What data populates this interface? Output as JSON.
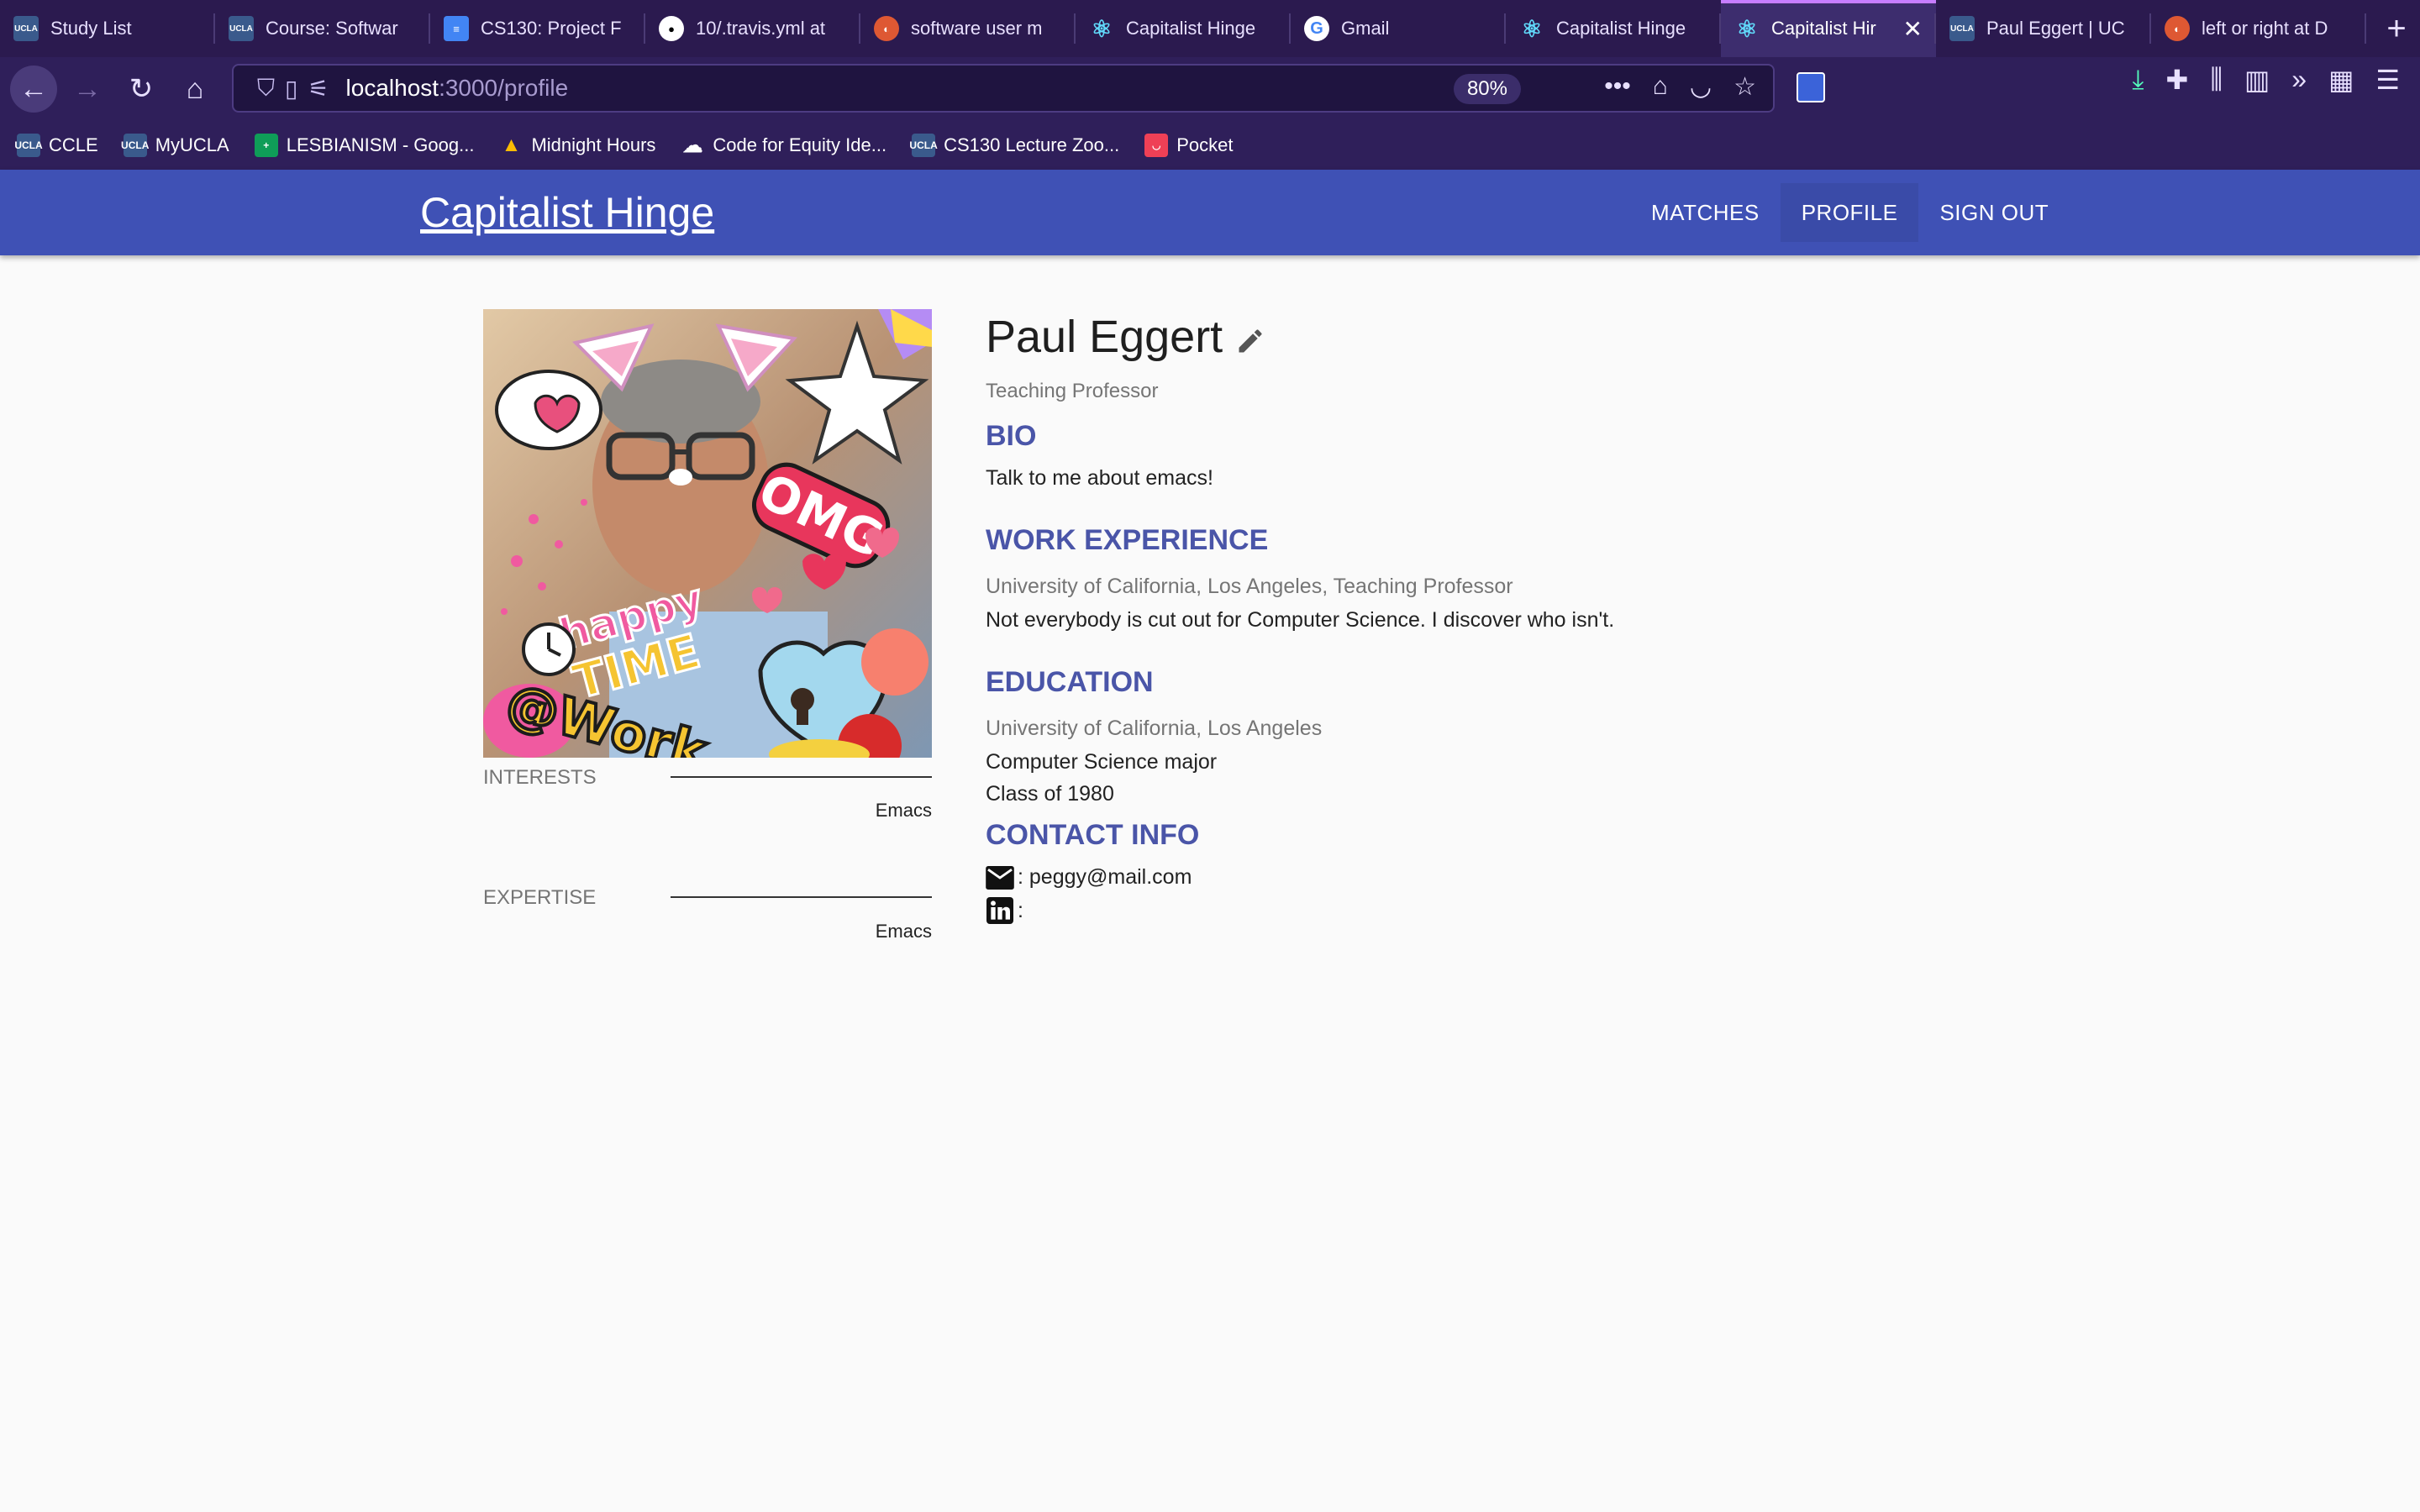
{
  "browser": {
    "tabs": [
      {
        "label": "Study List",
        "icon": "ucla-icon"
      },
      {
        "label": "Course: Softwar",
        "icon": "ucla-icon"
      },
      {
        "label": "CS130: Project F",
        "icon": "google-docs-icon"
      },
      {
        "label": "10/.travis.yml at",
        "icon": "github-icon"
      },
      {
        "label": "software user m",
        "icon": "duckduckgo-icon"
      },
      {
        "label": "Capitalist Hinge",
        "icon": "react-icon"
      },
      {
        "label": "Gmail",
        "icon": "google-icon"
      },
      {
        "label": "Capitalist Hinge",
        "icon": "react-icon"
      },
      {
        "label": "Capitalist Hir",
        "icon": "react-icon",
        "active": true
      },
      {
        "label": "Paul Eggert | UC",
        "icon": "ucla-icon"
      },
      {
        "label": "left or right at D",
        "icon": "duckduckgo-icon"
      }
    ],
    "url_host": "localhost",
    "url_path": ":3000/profile",
    "zoom": "80%",
    "bookmarks": [
      {
        "label": "CCLE",
        "icon": "ucla-icon"
      },
      {
        "label": "MyUCLA",
        "icon": "ucla-icon"
      },
      {
        "label": "LESBIANISM - Goog...",
        "icon": "google-sheets-icon"
      },
      {
        "label": "Midnight Hours",
        "icon": "google-drive-icon"
      },
      {
        "label": "Code for Equity Ide...",
        "icon": "cloud-icon"
      },
      {
        "label": "CS130 Lecture Zoo...",
        "icon": "ucla-icon"
      },
      {
        "label": "Pocket",
        "icon": "pocket-icon"
      }
    ]
  },
  "app": {
    "brand": "Capitalist Hinge",
    "menu": {
      "matches": "MATCHES",
      "profile": "PROFILE",
      "sign_out": "SIGN OUT"
    },
    "colors": {
      "primary": "#3f51b5",
      "section_heading": "#4a55a8"
    }
  },
  "profile": {
    "name": "Paul Eggert",
    "title": "Teaching Professor",
    "bio_heading": "BIO",
    "bio": "Talk to me about emacs!",
    "work_heading": "WORK EXPERIENCE",
    "work_org": "University of California, Los Angeles, Teaching Professor",
    "work_desc": "Not everybody is cut out for Computer Science. I discover who isn't.",
    "education_heading": "EDUCATION",
    "edu_school": "University of California, Los Angeles",
    "edu_major": "Computer Science major",
    "edu_class": "Class of 1980",
    "contact_heading": "CONTACT INFO",
    "email": ": peggy@mail.com",
    "linkedin": ":",
    "interests_label": "INTERESTS",
    "interests_value": "Emacs",
    "expertise_label": "EXPERTISE",
    "expertise_value": "Emacs",
    "photo_stickers": [
      "OMG",
      "happy",
      "TIME",
      "@Work"
    ]
  }
}
